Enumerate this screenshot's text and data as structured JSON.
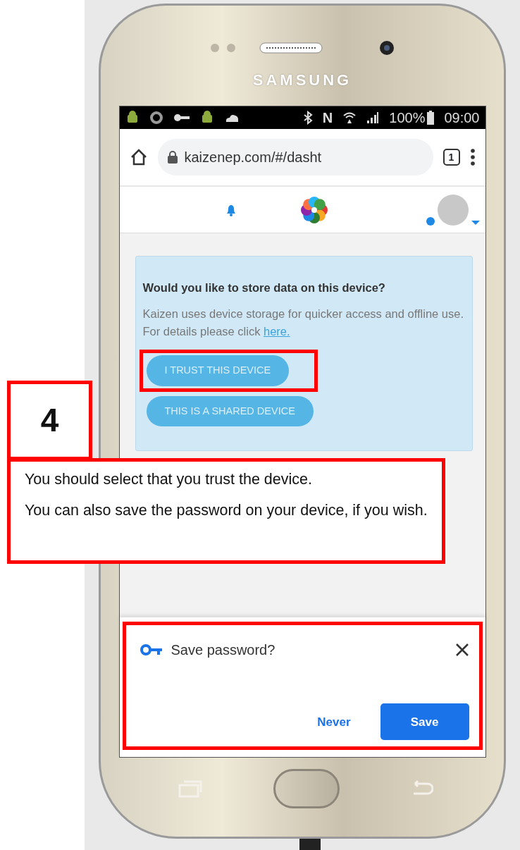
{
  "phone": {
    "brand": "SAMSUNG"
  },
  "status_bar": {
    "nfc": "N",
    "battery": "100%",
    "time": "09:00"
  },
  "browser": {
    "url": "kaizenep.com/#/dasht",
    "tab_count": "1"
  },
  "storage_dialog": {
    "title": "Would you like to store data on this device?",
    "body": "Kaizen uses device storage for quicker access and offline use. For details please click ",
    "link": "here.",
    "buttons": [
      {
        "label": "I TRUST THIS DEVICE",
        "highlighted": true
      },
      {
        "label": "THIS IS A SHARED DEVICE",
        "highlighted": false
      }
    ]
  },
  "password_prompt": {
    "title": "Save password?",
    "highlighted": true,
    "buttons": [
      {
        "label": "Never",
        "kind": "text"
      },
      {
        "label": "Save",
        "kind": "filled"
      }
    ]
  },
  "step_badge": "4",
  "instruction": [
    "You should select that you trust the device.",
    "You can also save the password on your device, if you wish."
  ]
}
